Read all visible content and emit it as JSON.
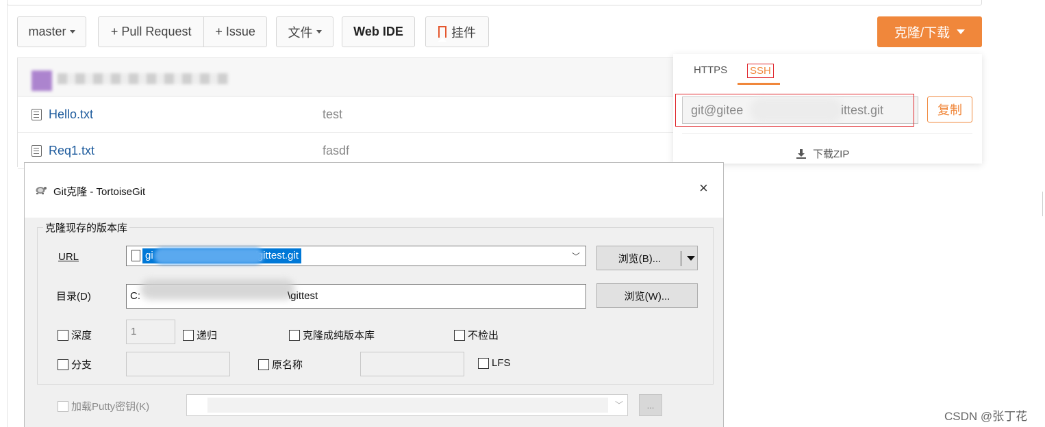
{
  "repo_toolbar": {
    "branch": "master",
    "pull_request": "+ Pull Request",
    "issue": "+ Issue",
    "files": "文件",
    "web_ide": "Web IDE",
    "plugin": "挂件",
    "clone_download": "克隆/下载"
  },
  "files": [
    {
      "name": "Hello.txt",
      "message": "test"
    },
    {
      "name": "Req1.txt",
      "message": "fasdf"
    }
  ],
  "clone_dropdown": {
    "tabs": [
      "HTTPS",
      "SSH"
    ],
    "active_tab": "SSH",
    "url_prefix": "git@gitee",
    "url_suffix": "ittest.git",
    "copy": "复制",
    "download_zip": "下载ZIP"
  },
  "dialog": {
    "title": "Git克隆 - TortoiseGit",
    "close": "×",
    "group_title": "克隆现存的版本库",
    "url_label": "URL",
    "url_value_start": "gi",
    "url_value_end": "/gittest.git",
    "dir_label": "目录(D)",
    "dir_value_start": "C:",
    "dir_value_end": "\\gittest",
    "browse_b": "浏览(B)...",
    "browse_w": "浏览(W)...",
    "depth_label": "深度",
    "depth_value": "1",
    "recursive_label": "递归",
    "bare_label": "克隆成纯版本库",
    "no_checkout_label": "不检出",
    "branch_label": "分支",
    "origin_label": "原名称",
    "lfs_label": "LFS",
    "putty_label": "加载Putty密钥(K)",
    "ellipsis": "..."
  },
  "watermark": "CSDN @张丁花",
  "colors": {
    "accent_orange": "#f0873b",
    "highlight_red": "#e0262c",
    "selection_blue": "#0078d7",
    "link_blue": "#1c5a9c"
  }
}
